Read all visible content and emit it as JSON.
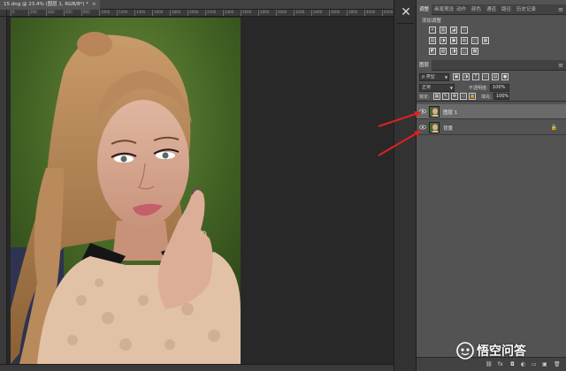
{
  "document": {
    "tab_title": "15.dng @ 23.4% (图层 1, RGB/8*) *",
    "close_glyph": "×"
  },
  "ruler": {
    "ticks": [
      "0",
      "200",
      "400",
      "600",
      "800",
      "1000",
      "1200",
      "1400",
      "1600",
      "1800",
      "2000",
      "2200",
      "2400",
      "2600",
      "2800",
      "3000",
      "3200",
      "3400",
      "3600",
      "3800",
      "4000",
      "4200"
    ]
  },
  "panel_strip": {
    "close_icon": "close-icon"
  },
  "adjust_panel": {
    "tabs": [
      "调整",
      "画笔预设",
      "动作",
      "颜色",
      "通道",
      "路径",
      "历史记录"
    ],
    "active_tab": 0,
    "title": "添加调整",
    "row1": [
      "☼",
      "▥",
      "◪",
      "▽"
    ],
    "row2": [
      "▤",
      "◑",
      "▣",
      "◍",
      "○",
      "▦"
    ],
    "row3": [
      "◩",
      "▧",
      "◨",
      "◻",
      "▩"
    ]
  },
  "layers_panel": {
    "tab": "图层",
    "filter_kind": "ρ 类型",
    "blend_mode": "正常",
    "opacity_label": "不透明度:",
    "opacity_value": "100%",
    "lock_label": "锁定:",
    "fill_label": "填充:",
    "fill_value": "100%",
    "filter_icons": [
      "▣",
      "◑",
      "T",
      "▭",
      "▤",
      "●"
    ],
    "lock_icons": [
      "▦",
      "✎",
      "✥",
      "▭",
      "🔒"
    ],
    "layers": [
      {
        "name": "图层 1",
        "selected": true,
        "visible": true,
        "locked": false
      },
      {
        "name": "背景",
        "selected": false,
        "visible": true,
        "locked": true
      }
    ],
    "lock_glyph": "🔒",
    "bottom_icons": [
      "⛓",
      "fx",
      "◘",
      "◐",
      "▭",
      "▣",
      "🗑"
    ]
  },
  "annotation_color": "#e02020",
  "watermark": {
    "text": "悟空问答"
  }
}
